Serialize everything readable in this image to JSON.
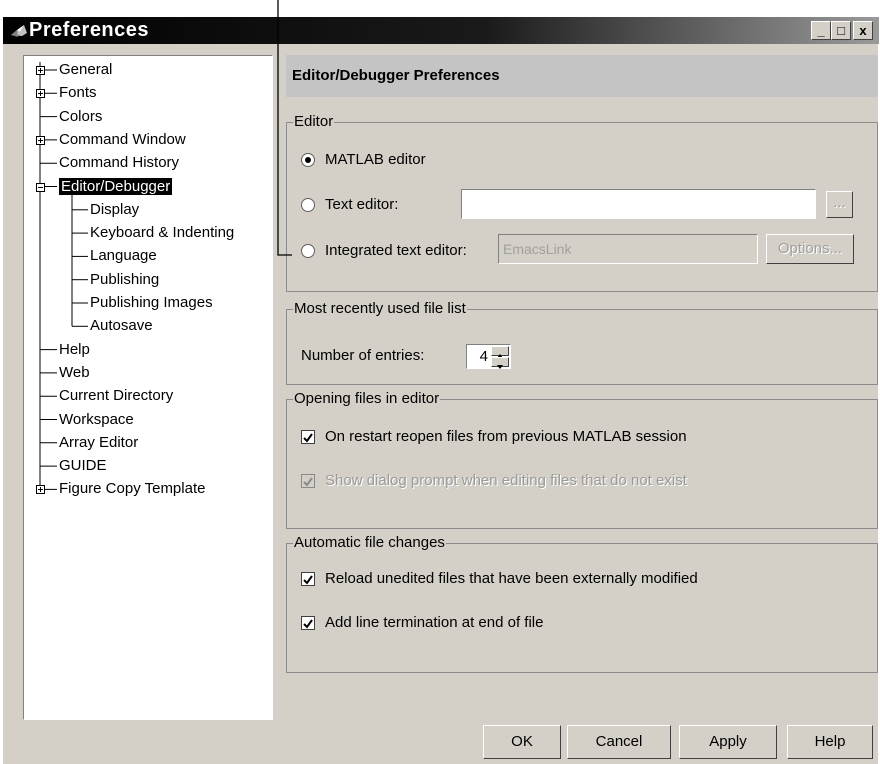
{
  "window": {
    "title": "Preferences",
    "min_glyph": "_",
    "max_glyph": "□",
    "close_glyph": "x"
  },
  "tree": {
    "items": [
      {
        "label": "General",
        "expander": "plus",
        "selected": false
      },
      {
        "label": "Fonts",
        "expander": "plus",
        "selected": false
      },
      {
        "label": "Colors",
        "expander": "",
        "selected": false
      },
      {
        "label": "Command Window",
        "expander": "plus",
        "selected": false
      },
      {
        "label": "Command History",
        "expander": "",
        "selected": false
      },
      {
        "label": "Editor/Debugger",
        "expander": "minus",
        "selected": true
      },
      {
        "label": "Display",
        "expander": "",
        "selected": false
      },
      {
        "label": "Keyboard & Indenting",
        "expander": "",
        "selected": false
      },
      {
        "label": "Language",
        "expander": "",
        "selected": false
      },
      {
        "label": "Publishing",
        "expander": "",
        "selected": false
      },
      {
        "label": "Publishing Images",
        "expander": "",
        "selected": false
      },
      {
        "label": "Autosave",
        "expander": "",
        "selected": false
      },
      {
        "label": "Help",
        "expander": "",
        "selected": false
      },
      {
        "label": "Web",
        "expander": "",
        "selected": false
      },
      {
        "label": "Current Directory",
        "expander": "",
        "selected": false
      },
      {
        "label": "Workspace",
        "expander": "",
        "selected": false
      },
      {
        "label": "Array Editor",
        "expander": "",
        "selected": false
      },
      {
        "label": "GUIDE",
        "expander": "",
        "selected": false
      },
      {
        "label": "Figure Copy Template",
        "expander": "plus",
        "selected": false
      }
    ]
  },
  "panel": {
    "header": "Editor/Debugger Preferences",
    "editor": {
      "legend": "Editor",
      "matlab_editor": "MATLAB editor",
      "text_editor": "Text editor:",
      "text_editor_value": "",
      "browse_label": "...",
      "integrated_editor": "Integrated text editor:",
      "integrated_value": "EmacsLink",
      "options_label": "Options..."
    },
    "mru": {
      "legend": "Most recently used file list",
      "entries_label": "Number of entries:",
      "entries_value": "4"
    },
    "opening": {
      "legend": "Opening files in editor",
      "reopen": "On restart reopen files from previous MATLAB session",
      "reopen_checked": true,
      "prompt": "Show dialog prompt when editing files that do not exist",
      "prompt_checked": true
    },
    "auto": {
      "legend": "Automatic file changes",
      "reload": "Reload unedited files that have been externally modified",
      "reload_checked": true,
      "line_term": "Add line termination at end of file",
      "line_term_checked": true
    }
  },
  "buttons": {
    "ok": "OK",
    "cancel": "Cancel",
    "apply": "Apply",
    "help": "Help"
  }
}
